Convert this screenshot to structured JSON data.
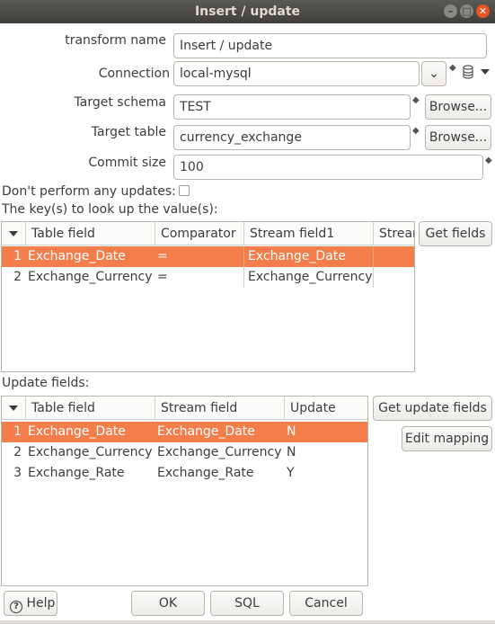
{
  "window": {
    "title": "Insert / update"
  },
  "form": {
    "transform_name_label": "transform name",
    "transform_name_value": "Insert / update",
    "connection_label": "Connection",
    "connection_value": "local-mysql",
    "target_schema_label": "Target schema",
    "target_schema_value": "TEST",
    "target_table_label": "Target table",
    "target_table_value": "currency_exchange",
    "commit_size_label": "Commit size",
    "commit_size_value": "100",
    "browse_label": "Browse...",
    "no_updates_label": "Don't perform any updates:",
    "no_updates_checked": false
  },
  "keys": {
    "section_label": "The key(s) to look up the value(s):",
    "get_fields_label": "Get fields",
    "columns": [
      "Table field",
      "Comparator",
      "Stream field1",
      "Stream"
    ],
    "rows": [
      {
        "index": "1",
        "table_field": "Exchange_Date",
        "comparator": "=",
        "stream_field1": "Exchange_Date",
        "stream_field2": ""
      },
      {
        "index": "2",
        "table_field": "Exchange_Currency",
        "comparator": "=",
        "stream_field1": "Exchange_Currency",
        "stream_field2": ""
      }
    ]
  },
  "update": {
    "section_label": "Update fields:",
    "get_update_fields_label": "Get update fields",
    "edit_mapping_label": "Edit mapping",
    "columns": [
      "Table field",
      "Stream field",
      "Update"
    ],
    "rows": [
      {
        "index": "1",
        "table_field": "Exchange_Date",
        "stream_field": "Exchange_Date",
        "update": "N"
      },
      {
        "index": "2",
        "table_field": "Exchange_Currency",
        "stream_field": "Exchange_Currency",
        "update": "N"
      },
      {
        "index": "3",
        "table_field": "Exchange_Rate",
        "stream_field": "Exchange_Rate",
        "update": "Y"
      }
    ]
  },
  "footer": {
    "help_label": "Help",
    "ok_label": "OK",
    "sql_label": "SQL",
    "cancel_label": "Cancel"
  },
  "colors": {
    "selection": "#f47d4c",
    "close_button": "#e95420",
    "titlebar": "#403f3b"
  }
}
